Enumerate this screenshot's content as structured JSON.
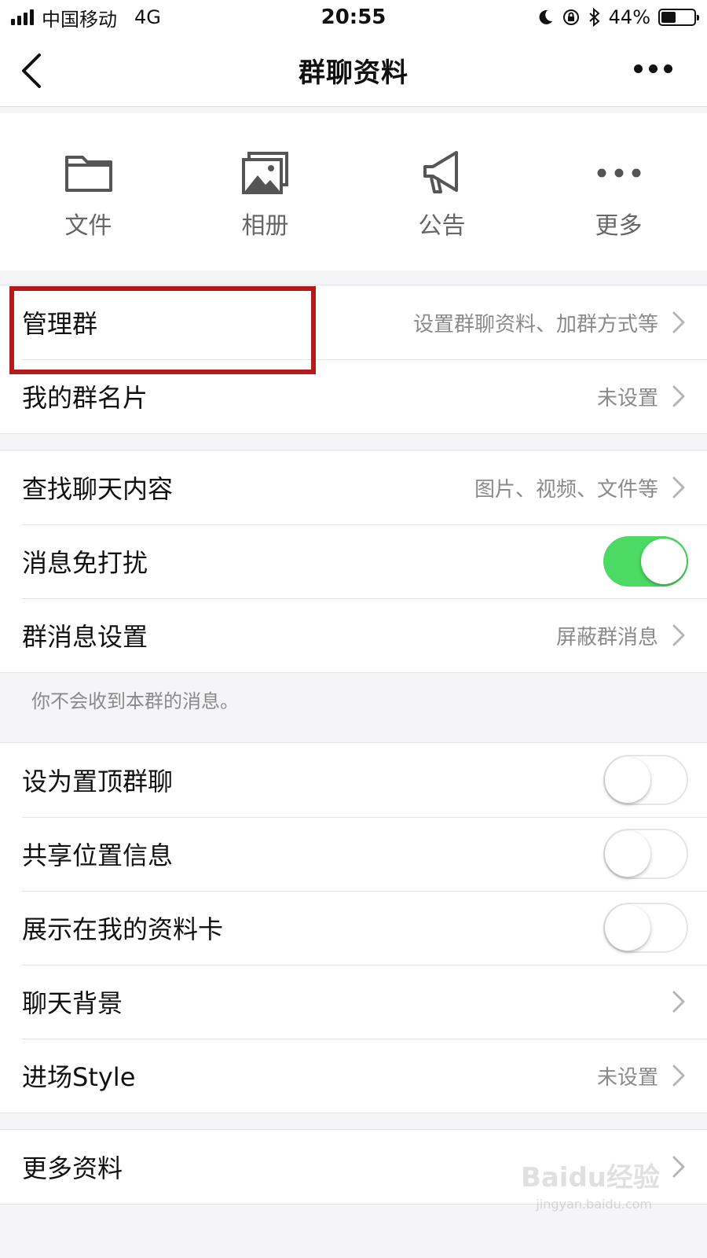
{
  "status_bar": {
    "carrier": "中国移动",
    "network": "4G",
    "time": "20:55",
    "battery_percent": "44%",
    "battery_level": 0.44
  },
  "nav": {
    "title": "群聊资料"
  },
  "quick_actions": [
    {
      "label": "文件",
      "icon": "folder-icon"
    },
    {
      "label": "相册",
      "icon": "photo-album-icon"
    },
    {
      "label": "公告",
      "icon": "megaphone-icon"
    },
    {
      "label": "更多",
      "icon": "more-dots-icon"
    }
  ],
  "group1": {
    "manage": {
      "label": "管理群",
      "value": "设置群聊资料、加群方式等"
    },
    "nickname": {
      "label": "我的群名片",
      "value": "未设置"
    }
  },
  "group2": {
    "search": {
      "label": "查找聊天内容",
      "value": "图片、视频、文件等"
    },
    "dnd": {
      "label": "消息免打扰",
      "on": true
    },
    "msg_settings": {
      "label": "群消息设置",
      "value": "屏蔽群消息"
    },
    "note": "你不会收到本群的消息。"
  },
  "group3": {
    "pin": {
      "label": "设为置顶群聊",
      "on": false
    },
    "location": {
      "label": "共享位置信息",
      "on": false
    },
    "show_card": {
      "label": "展示在我的资料卡",
      "on": false
    },
    "background": {
      "label": "聊天背景"
    },
    "entrance": {
      "label": "进场Style",
      "value": "未设置"
    }
  },
  "group4": {
    "more_info": {
      "label": "更多资料"
    }
  },
  "watermark": {
    "main": "Baidu经验",
    "sub": "jingyan.baidu.com"
  },
  "colors": {
    "toggle_on": "#4cd964",
    "highlight": "#b41c1c"
  }
}
